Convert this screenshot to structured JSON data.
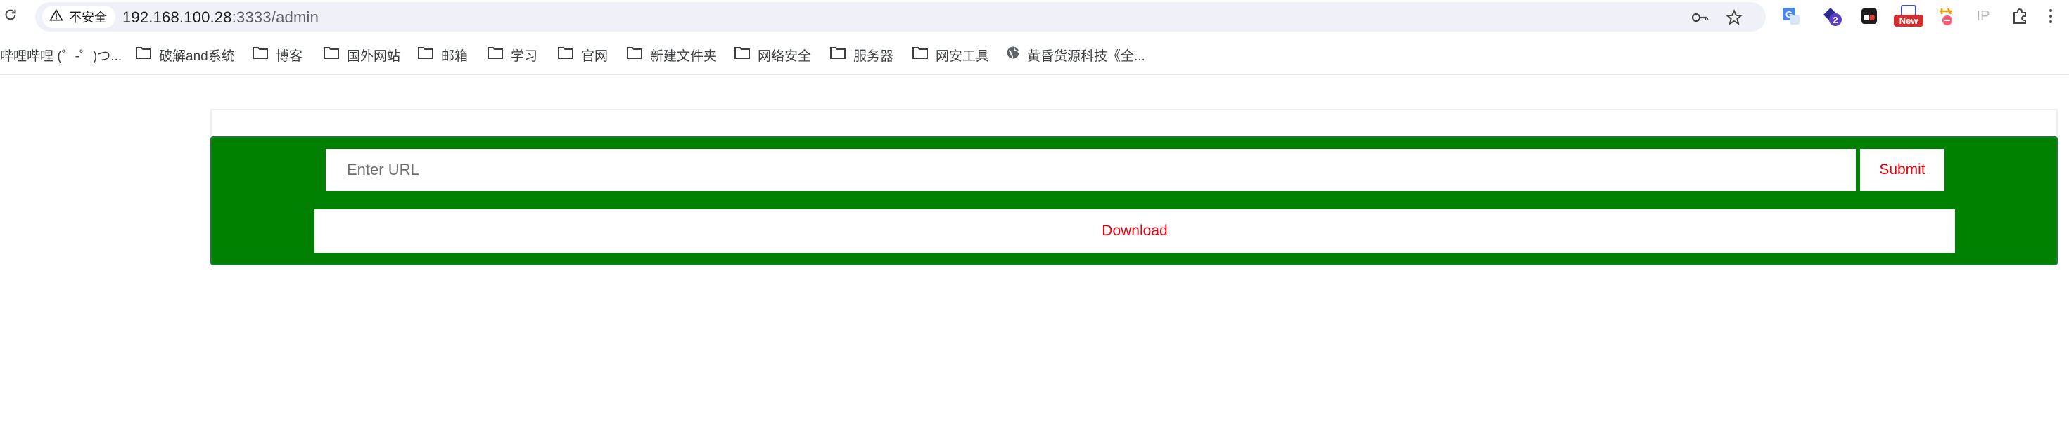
{
  "browser": {
    "security_label": "不安全",
    "url_host": "192.168.100.28",
    "url_path": ":3333/admin",
    "extensions": {
      "translate_icon": "G",
      "badge_count": "2",
      "new_badge": "New",
      "ip_label": "IP"
    }
  },
  "bookmarks": [
    {
      "label": "哔哩哔哩 (゜-゜)つ...",
      "icon": "none"
    },
    {
      "label": "破解and系统",
      "icon": "folder-icon"
    },
    {
      "label": "博客",
      "icon": "folder-icon"
    },
    {
      "label": "国外网站",
      "icon": "folder-icon"
    },
    {
      "label": "邮箱",
      "icon": "folder-icon"
    },
    {
      "label": "学习",
      "icon": "folder-icon"
    },
    {
      "label": "官网",
      "icon": "folder-icon"
    },
    {
      "label": "新建文件夹",
      "icon": "folder-icon"
    },
    {
      "label": "网络安全",
      "icon": "folder-icon"
    },
    {
      "label": "服务器",
      "icon": "folder-icon"
    },
    {
      "label": "网安工具",
      "icon": "folder-icon"
    },
    {
      "label": "黄昏货源科技《全...",
      "icon": "globe-icon"
    }
  ],
  "form": {
    "url_placeholder": "Enter URL",
    "submit_label": "Submit",
    "download_label": "Download"
  },
  "colors": {
    "panel_green": "#008000",
    "button_text_red": "#e8000b"
  }
}
